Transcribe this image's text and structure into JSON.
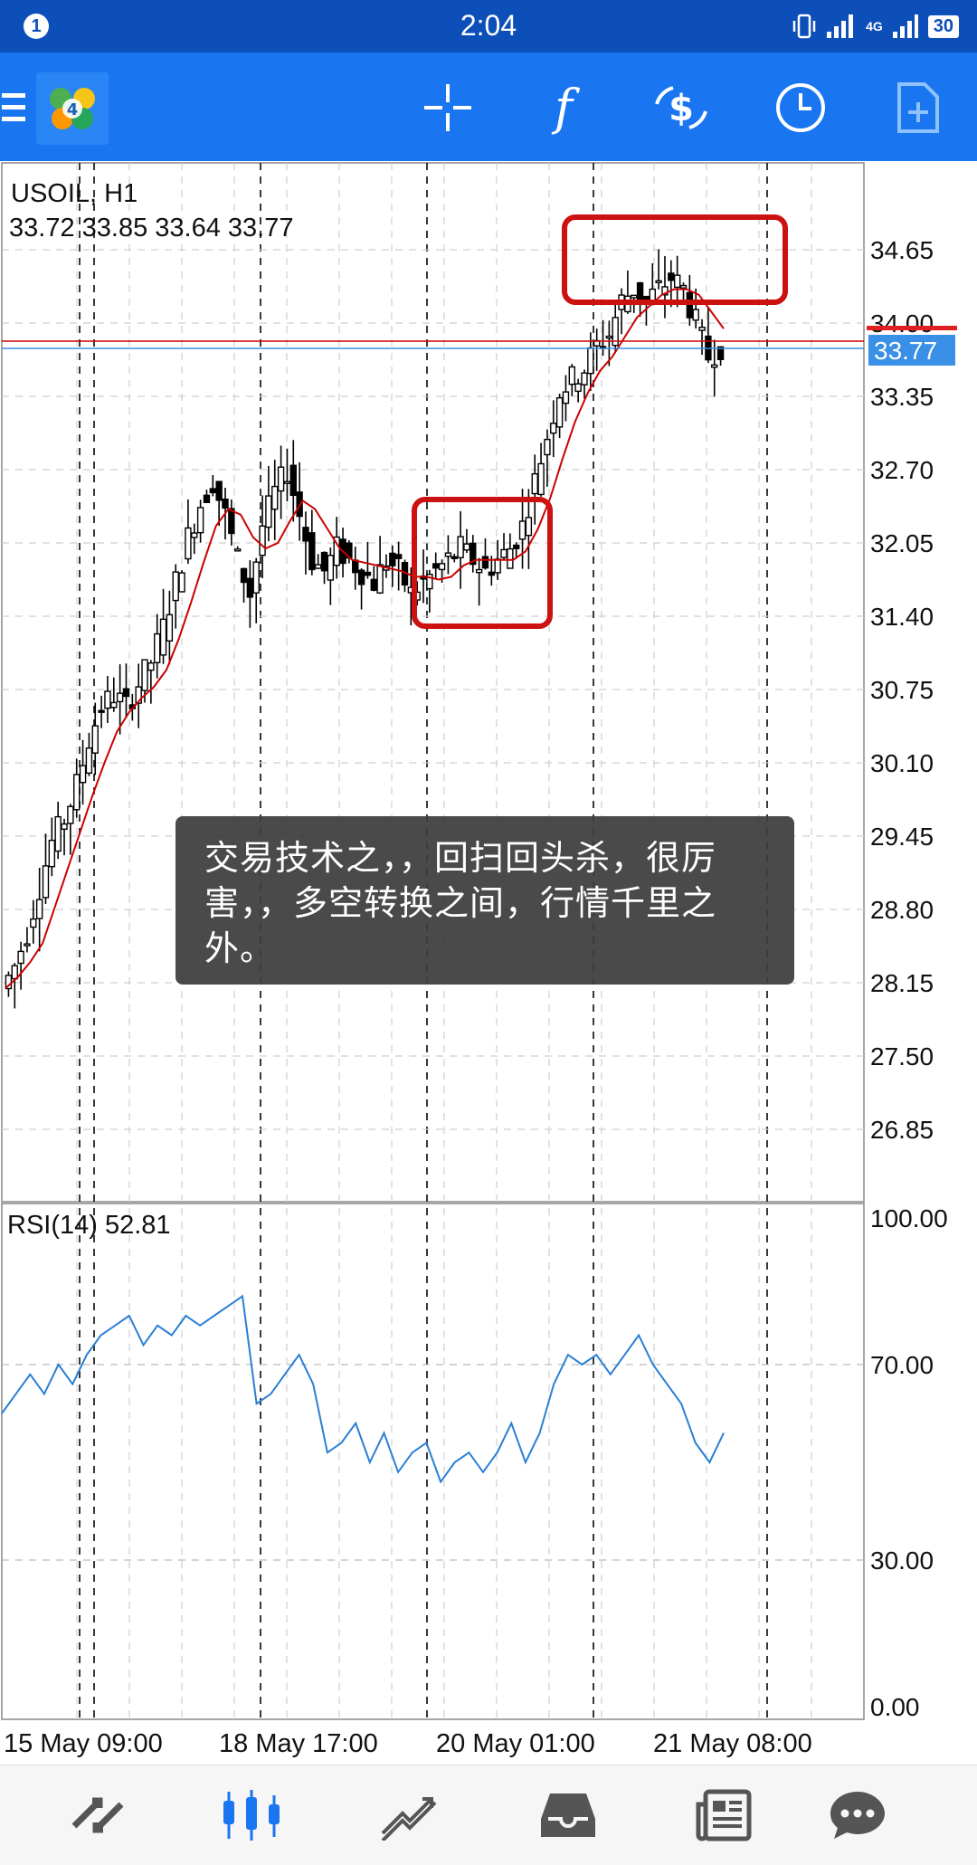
{
  "status_bar": {
    "notification_count": "1",
    "time": "2:04",
    "network": "4G",
    "battery": "30"
  },
  "toolbar": {
    "tools": [
      "menu-icon",
      "metatrader-logo",
      "crosshair-icon",
      "indicators-icon",
      "symbols-icon",
      "timeframe-icon",
      "new-order-icon"
    ]
  },
  "chart": {
    "symbol_label": "USOIL, H1",
    "ohlc": "33.72 33.85 33.64 33.77",
    "current_price": "33.77",
    "rsi_label": "RSI(14) 52.81"
  },
  "overlay": {
    "text": "交易技术之，，回扫回头杀，很厉害，，多空转换之间，行情千里之外。"
  },
  "chart_data": {
    "type": "candlestick",
    "price_axis": {
      "ticks": [
        "34.65",
        "34.00",
        "33.35",
        "32.70",
        "32.05",
        "31.40",
        "30.75",
        "30.10",
        "29.45",
        "28.80",
        "28.15",
        "27.50",
        "26.85"
      ],
      "ylim": [
        26.2,
        35.0
      ]
    },
    "time_axis": {
      "labels": [
        "15 May 09:00",
        "18 May 17:00",
        "20 May 01:00",
        "21 May 08:00"
      ]
    },
    "rsi_axis": {
      "ticks": [
        "100.00",
        "70.00",
        "30.00",
        "0.00"
      ],
      "ylim": [
        0,
        100
      ]
    },
    "price_series": [
      28.1,
      28.3,
      28.6,
      29.0,
      29.4,
      29.6,
      29.9,
      30.3,
      30.6,
      30.7,
      30.6,
      30.8,
      31.0,
      31.3,
      31.7,
      32.1,
      32.4,
      32.6,
      32.3,
      31.9,
      31.6,
      32.2,
      32.5,
      32.7,
      32.3,
      31.9,
      31.8,
      32.0,
      31.9,
      31.8,
      31.7,
      31.9,
      31.8,
      31.6,
      31.7,
      31.8,
      31.9,
      32.0,
      31.9,
      31.8,
      31.9,
      32.0,
      32.2,
      32.6,
      33.0,
      33.4,
      33.5,
      33.6,
      33.8,
      33.9,
      34.2,
      34.3,
      34.2,
      34.3,
      34.4,
      34.3,
      34.0,
      33.7,
      33.8
    ],
    "rsi_values": [
      60,
      64,
      68,
      64,
      70,
      66,
      72,
      76,
      78,
      80,
      74,
      78,
      76,
      80,
      78,
      80,
      82,
      84,
      62,
      64,
      68,
      72,
      66,
      52,
      54,
      58,
      50,
      56,
      48,
      52,
      54,
      46,
      50,
      52,
      48,
      52,
      58,
      50,
      56,
      66,
      72,
      70,
      72,
      68,
      72,
      76,
      70,
      66,
      62,
      54,
      50,
      56
    ]
  },
  "bottom_nav": {
    "items": [
      "quotes-icon",
      "chart-icon",
      "trade-icon",
      "history-icon",
      "news-icon",
      "chat-icon"
    ]
  },
  "colors": {
    "status_bar": "#0d4fb8",
    "toolbar": "#1976f0",
    "candle": "#000000",
    "ma_line": "#cc0000",
    "rsi_line": "#2a7fd4",
    "price_tag": "#3a8fe6",
    "highlight_box": "#cc1111"
  }
}
